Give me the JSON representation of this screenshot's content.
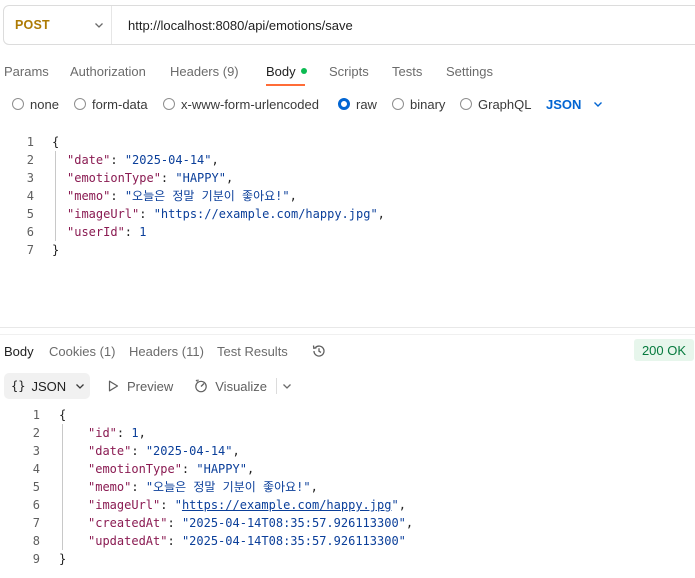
{
  "request": {
    "method": "POST",
    "url": "http://localhost:8080/api/emotions/save"
  },
  "request_tabs": [
    {
      "label": "Params"
    },
    {
      "label": "Authorization"
    },
    {
      "label": "Headers (9)"
    },
    {
      "label": "Body",
      "active": true
    },
    {
      "label": "Scripts"
    },
    {
      "label": "Tests"
    },
    {
      "label": "Settings"
    }
  ],
  "body_types": [
    {
      "label": "none",
      "checked": false
    },
    {
      "label": "form-data",
      "checked": false
    },
    {
      "label": "x-www-form-urlencoded",
      "checked": false
    },
    {
      "label": "raw",
      "checked": true
    },
    {
      "label": "binary",
      "checked": false
    },
    {
      "label": "GraphQL",
      "checked": false
    }
  ],
  "body_language": "JSON",
  "request_body": {
    "line_numbers": [
      "1",
      "2",
      "3",
      "4",
      "5",
      "6",
      "7"
    ],
    "open_brace": "{",
    "close_brace": "}",
    "fields": [
      {
        "key": "\"date\"",
        "value": "\"2025-04-14\"",
        "kind": "str",
        "comma": ","
      },
      {
        "key": "\"emotionType\"",
        "value": "\"HAPPY\"",
        "kind": "str",
        "comma": ","
      },
      {
        "key": "\"memo\"",
        "value": "\"오늘은 정말 기분이 좋아요!\"",
        "kind": "str",
        "comma": ","
      },
      {
        "key": "\"imageUrl\"",
        "value": "\"https://example.com/happy.jpg\"",
        "kind": "str",
        "comma": ","
      },
      {
        "key": "\"userId\"",
        "value": "1",
        "kind": "num",
        "comma": ""
      }
    ]
  },
  "response_tabs": [
    {
      "label": "Body",
      "active": true
    },
    {
      "label": "Cookies (1)"
    },
    {
      "label": "Headers (11)"
    },
    {
      "label": "Test Results"
    }
  ],
  "response_status": "200 OK",
  "response_toolbar": {
    "format": "JSON",
    "braces": "{}",
    "preview": "Preview",
    "visualize": "Visualize"
  },
  "response_body": {
    "line_numbers": [
      "1",
      "2",
      "3",
      "4",
      "5",
      "6",
      "7",
      "8",
      "9"
    ],
    "open_brace": "{",
    "close_brace": "}",
    "fields": [
      {
        "key": "\"id\"",
        "value": "1",
        "kind": "num",
        "comma": ","
      },
      {
        "key": "\"date\"",
        "value": "\"2025-04-14\"",
        "kind": "str",
        "comma": ","
      },
      {
        "key": "\"emotionType\"",
        "value": "\"HAPPY\"",
        "kind": "str",
        "comma": ","
      },
      {
        "key": "\"memo\"",
        "value": "\"오늘은 정말 기분이 좋아요!\"",
        "kind": "str",
        "comma": ","
      },
      {
        "key": "\"imageUrl\"",
        "quote_open": "\"",
        "value": "https://example.com/happy.jpg",
        "quote_close": "\"",
        "kind": "link",
        "comma": ","
      },
      {
        "key": "\"createdAt\"",
        "value": "\"2025-04-14T08:35:57.926113300\"",
        "kind": "str",
        "comma": ","
      },
      {
        "key": "\"updatedAt\"",
        "value": "\"2025-04-14T08:35:57.926113300\"",
        "kind": "str",
        "comma": ""
      }
    ]
  },
  "colors": {
    "method": "#ad7a03",
    "active_tab_underline": "#ff6c37",
    "body_dot": "#0cbb52",
    "accent_blue": "#0265d2",
    "status_bg": "#e7f6ec",
    "status_text": "#067a3e"
  },
  "icons": [
    "chevron-down-icon",
    "preview-play-icon",
    "visualize-icon",
    "history-icon"
  ]
}
